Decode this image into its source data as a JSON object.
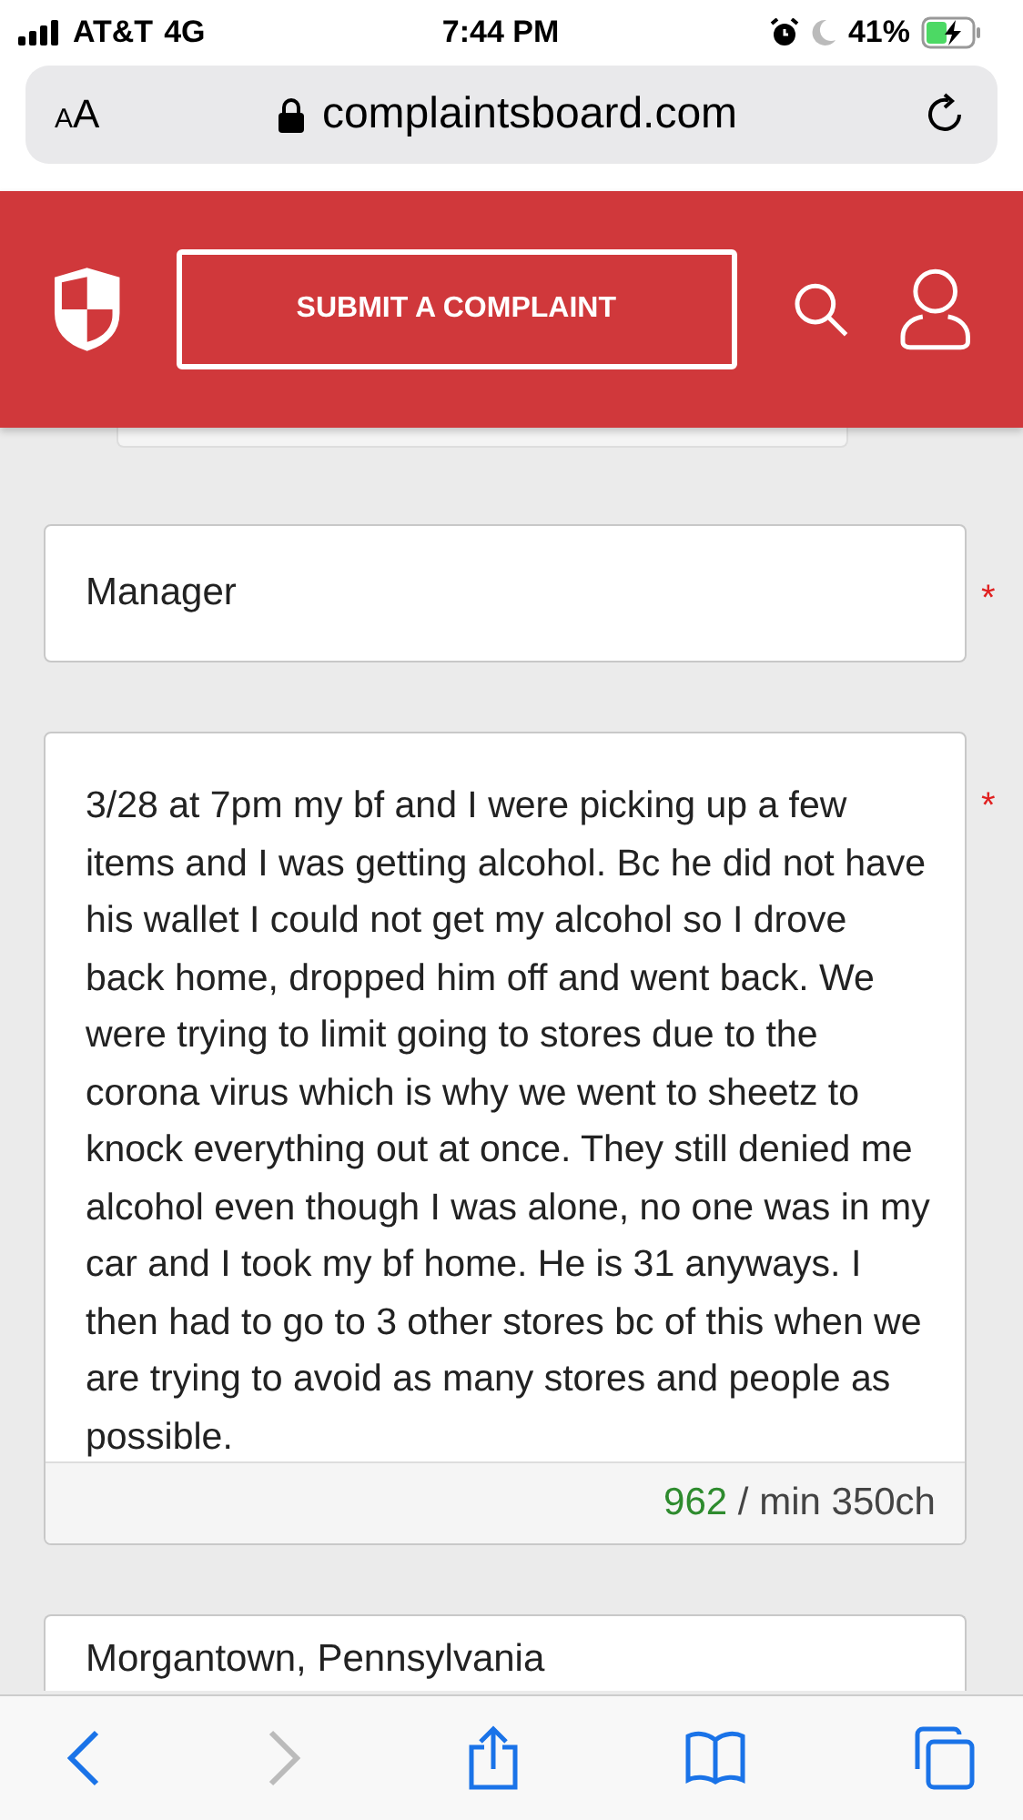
{
  "status_bar": {
    "carrier": "AT&T",
    "network": "4G",
    "time": "7:44 PM",
    "battery": "41%",
    "charging": true
  },
  "address_bar": {
    "text_size_label": "AA",
    "url": "complaintsboard.com",
    "secure": true
  },
  "header": {
    "submit_button": "SUBMIT A COMPLAINT"
  },
  "form": {
    "fields": [
      {
        "kind": "input",
        "value": "Manager",
        "required_mark": "*"
      },
      {
        "kind": "textarea",
        "value": "3/28 at 7pm my bf and I were picking up a few items and I was getting alcohol. Bc he did not have his wallet I could not get my alcohol so I drove back home, dropped him off and went back. We were trying to limit going to stores due to the corona virus which is why we went to sheetz to knock everything out at once. They still denied me alcohol even though I was alone, no one was in my car and I took my bf home. He is 31 anyways. I then had to go to 3 other stores bc of this when we are trying to avoid as many stores and people as possible.",
        "required_mark": "*",
        "char_count": "962",
        "char_min": " / min 350ch"
      },
      {
        "kind": "input",
        "value": "Morgantown, Pennsylvania"
      }
    ]
  },
  "toolbar": {
    "items": [
      {
        "kind": "back",
        "disabled": false
      },
      {
        "kind": "forward",
        "disabled": true
      },
      {
        "kind": "share",
        "disabled": false
      },
      {
        "kind": "bookmarks",
        "disabled": false
      },
      {
        "kind": "tabs",
        "disabled": false
      }
    ]
  }
}
